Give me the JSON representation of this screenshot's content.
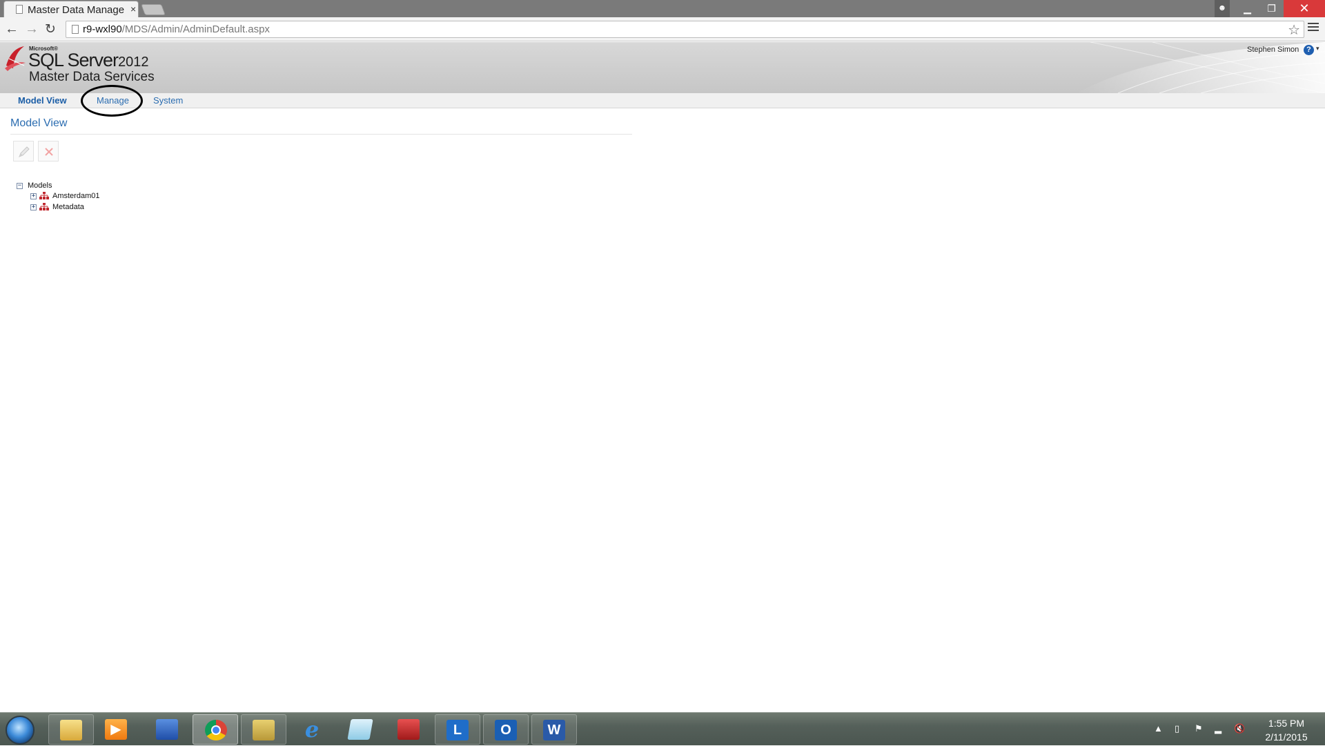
{
  "browser": {
    "tab_title": "Master Data Manage",
    "tab_close": "×",
    "url_host": "r9-wxl90",
    "url_path": "/MDS/Admin/AdminDefault.aspx",
    "window_buttons": [
      "▁",
      "❐",
      "✕"
    ]
  },
  "header": {
    "microsoft": "Microsoft®",
    "product": "SQL Server",
    "year": "2012",
    "subtitle": "Master Data Services",
    "user": "Stephen Simon",
    "help": "?"
  },
  "nav": {
    "items": [
      {
        "label": "Model View",
        "active": true
      },
      {
        "label": "Manage",
        "active": false
      },
      {
        "label": "System",
        "active": false
      }
    ]
  },
  "main": {
    "title": "Model View",
    "tree": {
      "root": {
        "label": "Models",
        "toggle": "−"
      },
      "children": [
        {
          "label": "Amsterdam01",
          "toggle": "+"
        },
        {
          "label": "Metadata",
          "toggle": "+"
        }
      ]
    }
  },
  "taskbar": {
    "apps": [
      "start-orb",
      "file-explorer",
      "media-player",
      "remote-desktop",
      "chrome",
      "data-tools",
      "internet-explorer",
      "notepad",
      "toolbox",
      "lync",
      "outlook",
      "word"
    ],
    "time": "1:55 PM",
    "date": "2/11/2015"
  }
}
